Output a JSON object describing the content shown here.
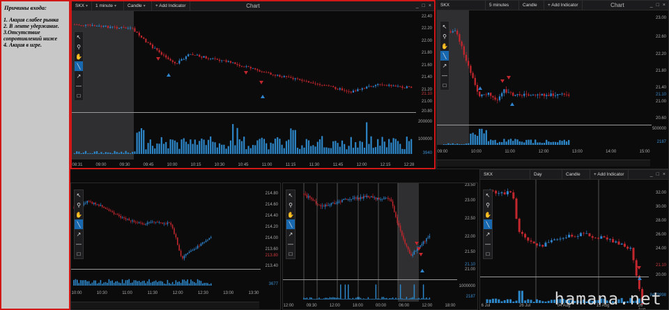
{
  "notes": {
    "title": "Причины входа:",
    "items": [
      "1. Акция слабее рынка",
      "2. В ленте удержание.",
      "3.Отсутствие сопротивлений ниже",
      "4. Акция в игре."
    ]
  },
  "watermark": "hamana.net",
  "windows": {
    "main": {
      "ticker": "SKX",
      "timeframe": "1 minute",
      "chart_type": "Candle",
      "add_indicator": "+ Add Indicator",
      "title": "Chart",
      "controls": [
        "_",
        "□",
        "×"
      ],
      "prices": [
        "22.40",
        "22.20",
        "22.00",
        "21.80",
        "21.60",
        "21.40",
        "21.20",
        "21.10",
        "21.00",
        "20.80"
      ],
      "last": "21.10",
      "vol_labels": [
        "200000",
        "100000"
      ],
      "vol_last": "3940",
      "times": [
        "08:31",
        "09:00",
        "09:30",
        "09:45",
        "10:00",
        "10:15",
        "10:30",
        "10:45",
        "11:00",
        "11:15",
        "11:30",
        "11:45",
        "12:00",
        "12:15",
        "12:28"
      ]
    },
    "tr": {
      "ticker": "SKX",
      "timeframe": "5 minutes",
      "chart_type": "Candle",
      "add_indicator": "+ Add Indicator",
      "title": "Chart",
      "controls": [
        "_",
        "□",
        "×"
      ],
      "prices": [
        "23.00",
        "22.60",
        "22.20",
        "21.80",
        "21.40",
        "21.10",
        "21.00",
        "20.60"
      ],
      "vol_label": "500000",
      "vol_last": "2187",
      "times": [
        "09:00",
        "10:00",
        "11:00",
        "12:00",
        "13:00",
        "14:00",
        "15:00"
      ]
    },
    "bl": {
      "prices": [
        "214.80",
        "214.60",
        "214.40",
        "214.20",
        "214.00",
        "213.80",
        "213.60",
        "213.40"
      ],
      "last": "213.80",
      "vol_last": "3677",
      "times": [
        "10:00",
        "10:30",
        "11:00",
        "11:30",
        "12:00",
        "12:30",
        "13:00",
        "13:30"
      ]
    },
    "bm": {
      "prices": [
        "23.50",
        "23.00",
        "22.50",
        "22.00",
        "21.50",
        "21.10",
        "21.00"
      ],
      "vol_label": "1000000",
      "vol_last": "2187",
      "times": [
        "12:00",
        "09:30",
        "12:00",
        "18:00",
        "00:00",
        "06:00",
        "12:00",
        "18:00"
      ]
    },
    "br": {
      "ticker": "SKX",
      "timeframe": "Day",
      "chart_type": "Candle",
      "add_indicator": "+ Add Indicator",
      "controls": [
        "_",
        "□",
        "×"
      ],
      "prices": [
        "32.00",
        "30.00",
        "28.00",
        "26.00",
        "24.00",
        "21.10",
        "20.00"
      ],
      "vol_last": "8479998",
      "times": [
        "6 Jul",
        "26 Jul",
        "04 Aug",
        "15 Aug",
        "26 Aug"
      ]
    }
  },
  "tools": [
    {
      "icon": "cursor-icon",
      "glyph": "↖"
    },
    {
      "icon": "zoom-icon",
      "glyph": "⚲"
    },
    {
      "icon": "hand-icon",
      "glyph": "✋"
    },
    {
      "icon": "line-icon",
      "glyph": "╲"
    },
    {
      "icon": "arrow-icon",
      "glyph": "↗"
    },
    {
      "icon": "hline-icon",
      "glyph": "—"
    },
    {
      "icon": "rect-icon",
      "glyph": "□"
    }
  ],
  "colors": {
    "up": "#2f86cf",
    "down": "#c1272d",
    "volume": "#2d86c7",
    "frame": "#d01818"
  }
}
